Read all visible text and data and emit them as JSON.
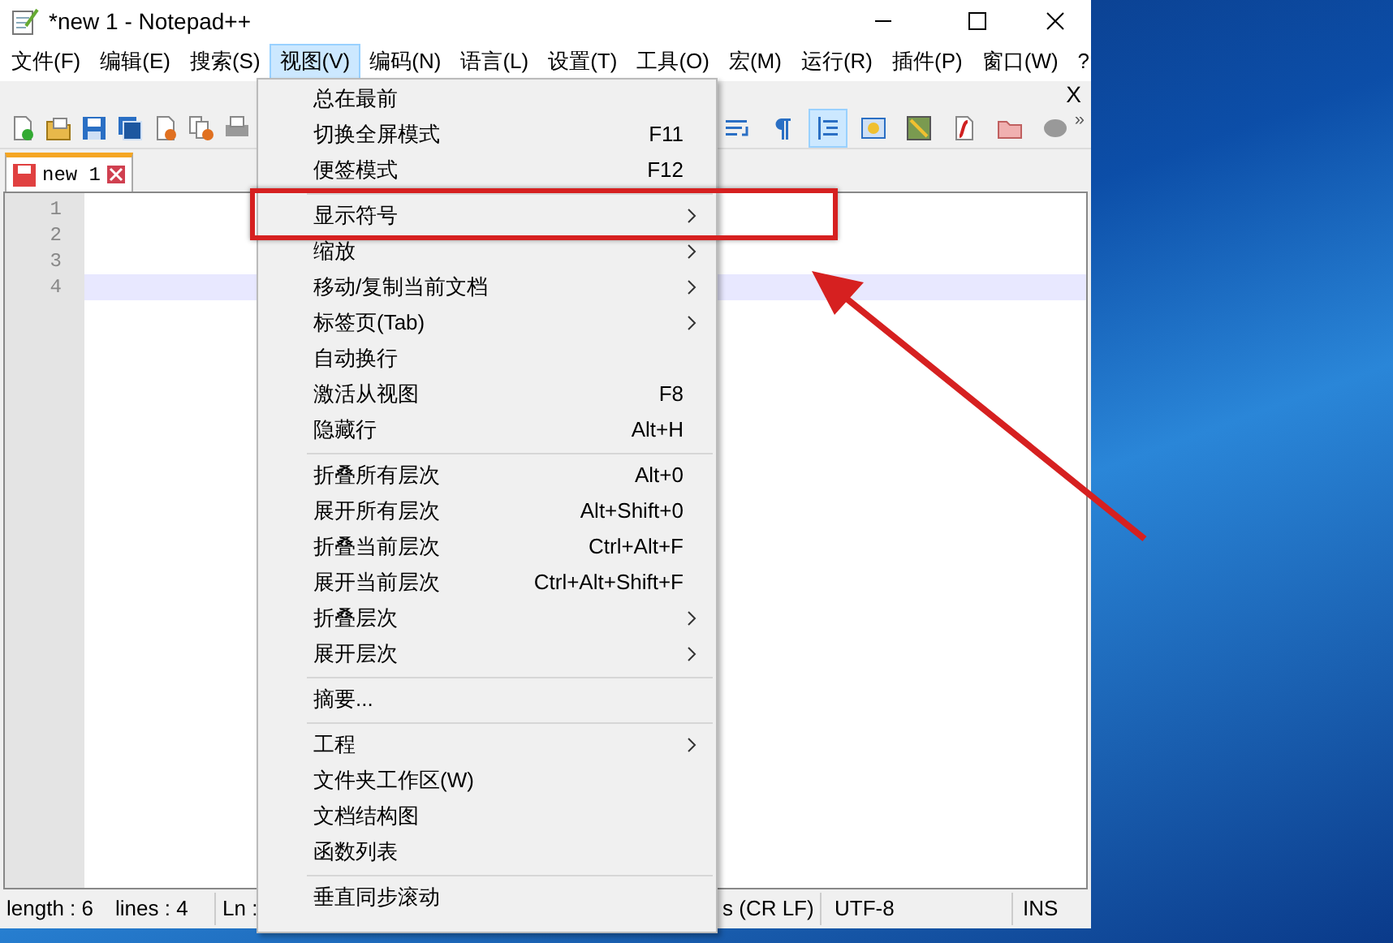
{
  "window": {
    "title": "*new 1 - Notepad++"
  },
  "menu_bar": [
    {
      "label": "文件(F)",
      "selected": false
    },
    {
      "label": "编辑(E)",
      "selected": false
    },
    {
      "label": "搜索(S)",
      "selected": false
    },
    {
      "label": "视图(V)",
      "selected": true
    },
    {
      "label": "编码(N)",
      "selected": false
    },
    {
      "label": "语言(L)",
      "selected": false
    },
    {
      "label": "设置(T)",
      "selected": false
    },
    {
      "label": "工具(O)",
      "selected": false
    },
    {
      "label": "宏(M)",
      "selected": false
    },
    {
      "label": "运行(R)",
      "selected": false
    },
    {
      "label": "插件(P)",
      "selected": false
    },
    {
      "label": "窗口(W)",
      "selected": false
    },
    {
      "label": "?",
      "selected": false
    }
  ],
  "close_document": "X",
  "toolbar": {
    "buttons": [
      {
        "selected": false
      },
      {
        "selected": false
      },
      {
        "selected": true
      },
      {
        "selected": false
      },
      {
        "selected": false
      },
      {
        "selected": false
      },
      {
        "selected": false
      },
      {
        "selected": false
      }
    ],
    "overflow": "»"
  },
  "tabs": [
    {
      "label": "new 1",
      "selected": true
    }
  ],
  "editor": {
    "lines": [
      {
        "number": "1",
        "current": false
      },
      {
        "number": "2",
        "current": false
      },
      {
        "number": "3",
        "current": false
      },
      {
        "number": "4",
        "current": true
      }
    ]
  },
  "view_menu": [
    {
      "kind": "item",
      "label": "总在最前",
      "submenu": false,
      "annotated": false
    },
    {
      "kind": "item",
      "label": "切换全屏模式",
      "shortcut": "F11",
      "submenu": false,
      "annotated": false
    },
    {
      "kind": "item",
      "label": "便签模式",
      "shortcut": "F12",
      "submenu": false,
      "annotated": false
    },
    {
      "kind": "separator"
    },
    {
      "kind": "item",
      "label": "显示符号",
      "submenu": true,
      "annotated": true
    },
    {
      "kind": "item",
      "label": "缩放",
      "submenu": true,
      "annotated": false
    },
    {
      "kind": "item",
      "label": "移动/复制当前文档",
      "submenu": true,
      "annotated": false
    },
    {
      "kind": "item",
      "label": "标签页(Tab)",
      "submenu": true,
      "annotated": false
    },
    {
      "kind": "item",
      "label": "自动换行",
      "submenu": false,
      "annotated": false
    },
    {
      "kind": "item",
      "label": "激活从视图",
      "shortcut": "F8",
      "submenu": false,
      "annotated": false
    },
    {
      "kind": "item",
      "label": "隐藏行",
      "shortcut": "Alt+H",
      "submenu": false,
      "annotated": false
    },
    {
      "kind": "separator"
    },
    {
      "kind": "item",
      "label": "折叠所有层次",
      "shortcut": "Alt+0",
      "submenu": false,
      "annotated": false
    },
    {
      "kind": "item",
      "label": "展开所有层次",
      "shortcut": "Alt+Shift+0",
      "submenu": false,
      "annotated": false
    },
    {
      "kind": "item",
      "label": "折叠当前层次",
      "shortcut": "Ctrl+Alt+F",
      "submenu": false,
      "annotated": false
    },
    {
      "kind": "item",
      "label": "展开当前层次",
      "shortcut": "Ctrl+Alt+Shift+F",
      "submenu": false,
      "annotated": false
    },
    {
      "kind": "item",
      "label": "折叠层次",
      "submenu": true,
      "annotated": false
    },
    {
      "kind": "item",
      "label": "展开层次",
      "submenu": true,
      "annotated": false
    },
    {
      "kind": "separator"
    },
    {
      "kind": "item",
      "label": "摘要...",
      "submenu": false,
      "annotated": false
    },
    {
      "kind": "separator"
    },
    {
      "kind": "item",
      "label": "工程",
      "submenu": true,
      "annotated": false
    },
    {
      "kind": "item",
      "label": "文件夹工作区(W)",
      "submenu": false,
      "annotated": false
    },
    {
      "kind": "item",
      "label": "文档结构图",
      "submenu": false,
      "annotated": false
    },
    {
      "kind": "item",
      "label": "函数列表",
      "submenu": false,
      "annotated": false
    },
    {
      "kind": "separator"
    },
    {
      "kind": "item",
      "label": "垂直同步滚动",
      "submenu": false,
      "annotated": false
    }
  ],
  "status_bar": {
    "length": "length : 6",
    "lines": "lines : 4",
    "position": "Ln :",
    "eol": "s (CR LF)",
    "encoding": "UTF-8",
    "mode": "INS"
  }
}
